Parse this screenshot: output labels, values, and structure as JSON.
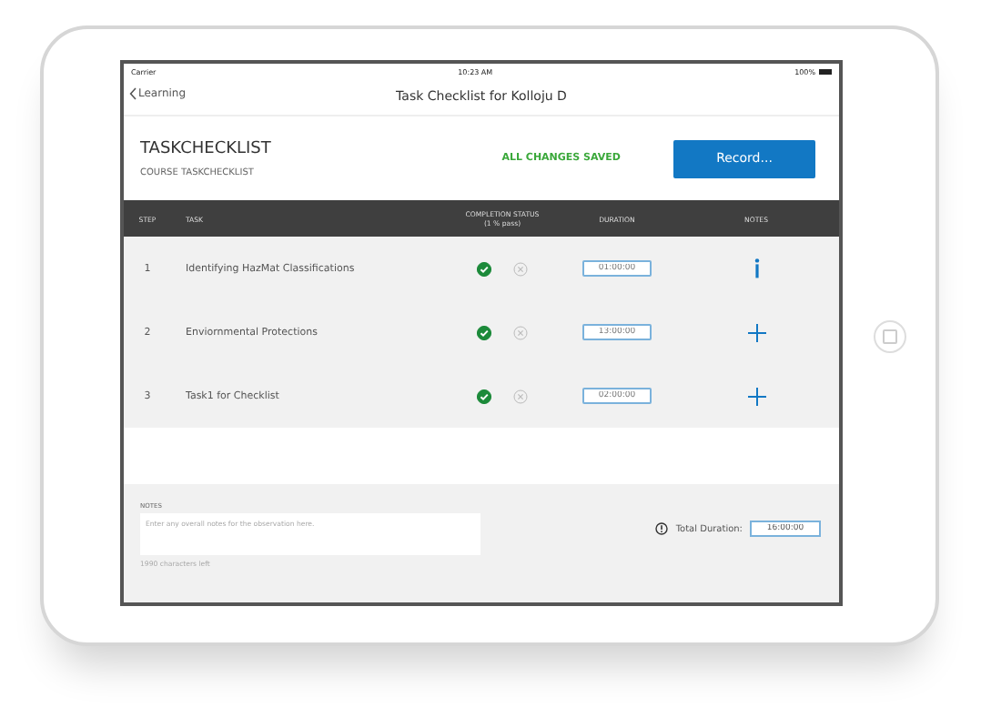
{
  "status_bar": {
    "carrier": "Carrier",
    "time": "10:23 AM",
    "battery": "100%"
  },
  "nav": {
    "back": "Learning",
    "title": "Task Checklist for Kolloju D"
  },
  "header": {
    "title": "TASKCHECKLIST",
    "subtitle": "COURSE TASKCHECKLIST",
    "save_status": "ALL CHANGES SAVED",
    "button": "Record..."
  },
  "table": {
    "columns": [
      "STEP",
      "TASK",
      "COMPLETION STATUS",
      "DURATION",
      "NOTES"
    ],
    "status_note": "(1 % pass)",
    "rows": [
      {
        "step": "1",
        "task": "Identifying HazMat Classifications",
        "passed": true,
        "failed": false,
        "duration": "01:00:00",
        "kind": "info"
      },
      {
        "step": "2",
        "task": "Enviornmental Protections",
        "passed": true,
        "failed": false,
        "duration": "13:00:00",
        "kind": "add"
      },
      {
        "step": "3",
        "task": "Task1 for Checklist",
        "passed": true,
        "failed": false,
        "duration": "02:00:00",
        "kind": "add"
      }
    ]
  },
  "footer": {
    "notes_label": "NOTES",
    "notes_placeholder": "Enter any overall notes for the observation here.",
    "chars_left": "1990 characters left",
    "total_label": "Total Duration:",
    "total_value": "16:00:00"
  }
}
